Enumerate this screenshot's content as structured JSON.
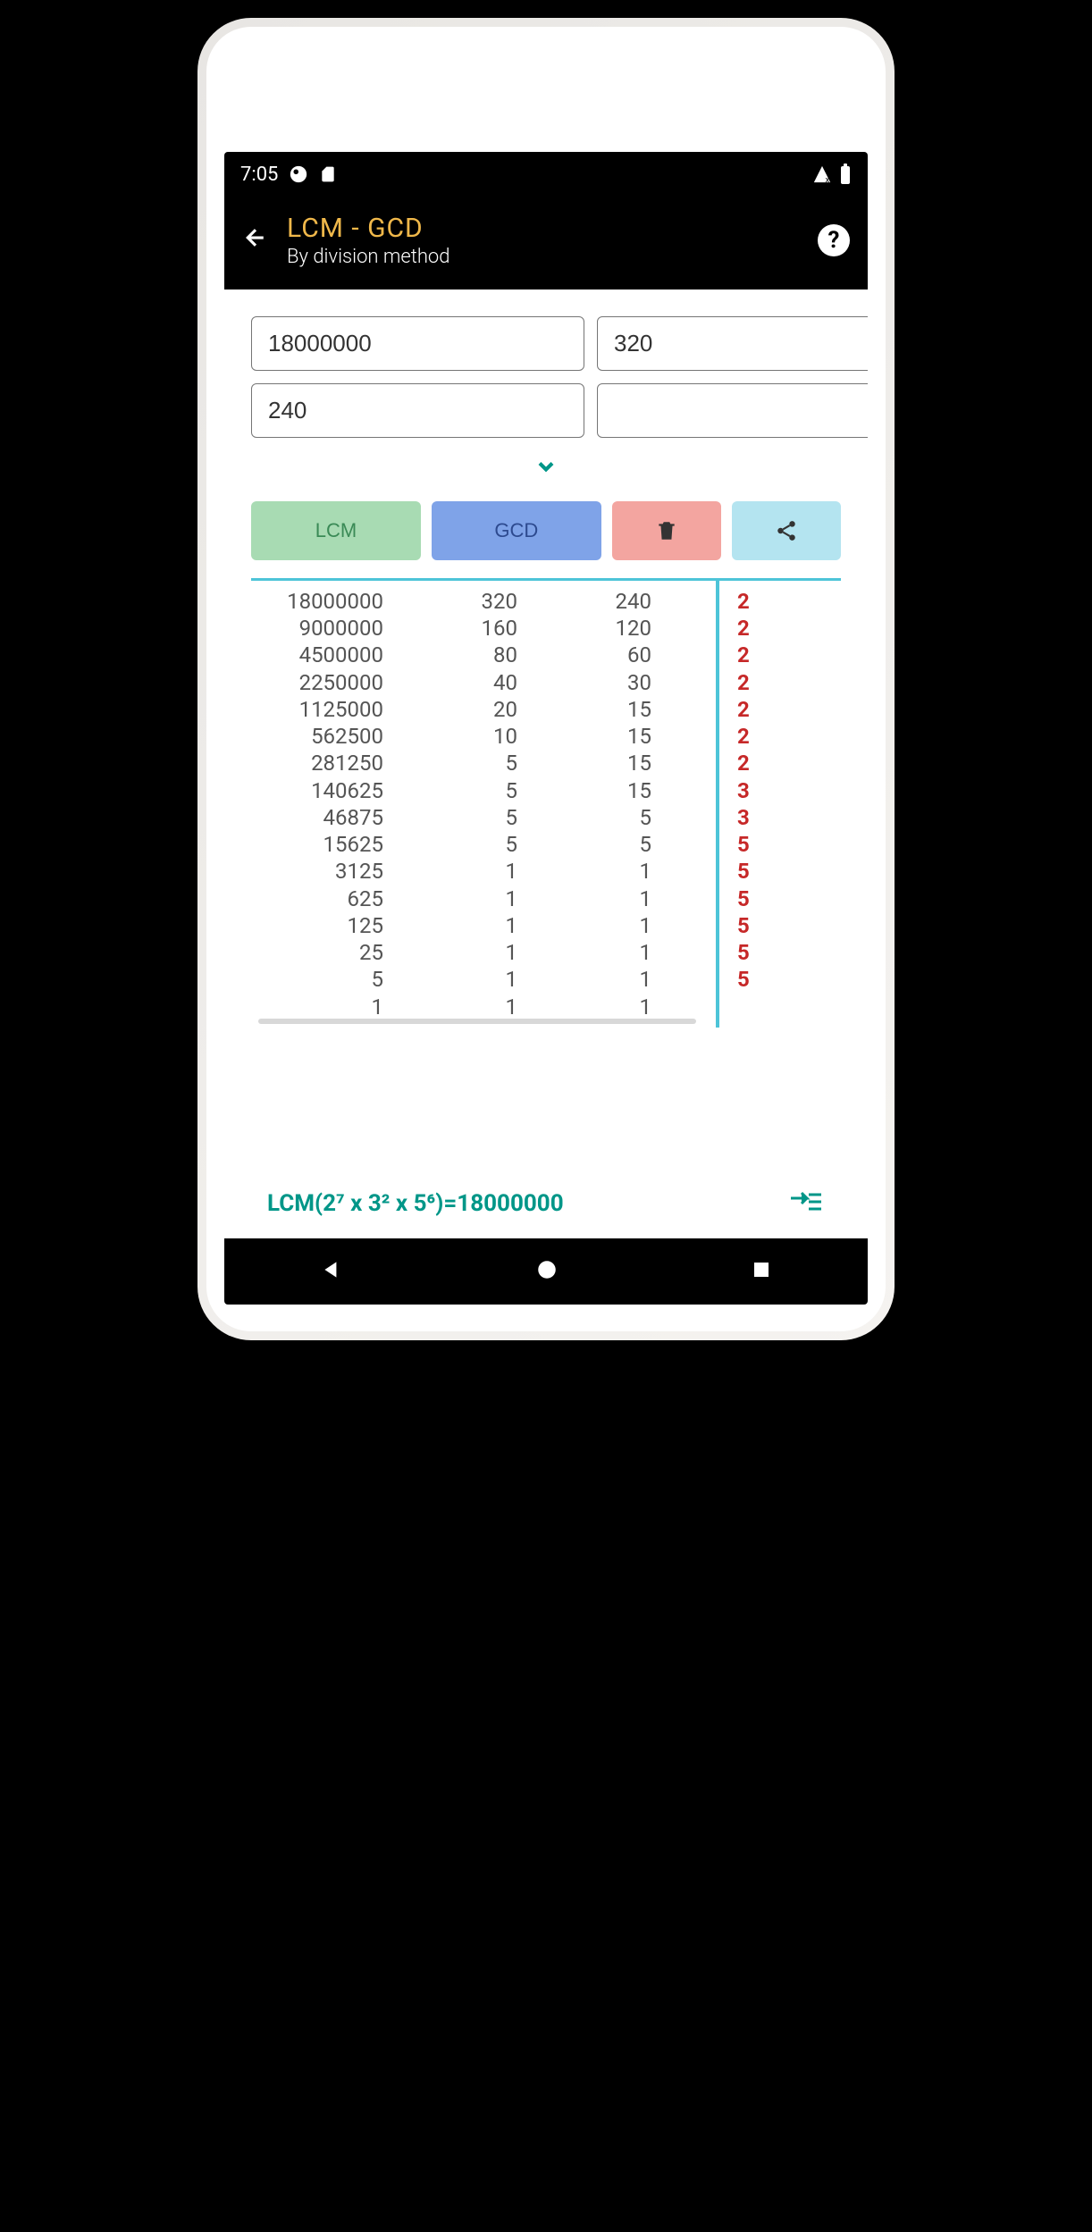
{
  "status": {
    "time": "7:05"
  },
  "appbar": {
    "title": "LCM - GCD",
    "subtitle": "By division method"
  },
  "inputs": {
    "a": "18000000",
    "b": "320",
    "c": "240",
    "d": ""
  },
  "buttons": {
    "lcm": "LCM",
    "gcd": "GCD"
  },
  "table": {
    "col1": [
      "18000000",
      "9000000",
      "4500000",
      "2250000",
      "1125000",
      "562500",
      "281250",
      "140625",
      "46875",
      "15625",
      "3125",
      "625",
      "125",
      "25",
      "5",
      "1"
    ],
    "col2": [
      "320",
      "160",
      "80",
      "40",
      "20",
      "10",
      "5",
      "5",
      "5",
      "5",
      "1",
      "1",
      "1",
      "1",
      "1",
      "1"
    ],
    "col3": [
      "240",
      "120",
      "60",
      "30",
      "15",
      "15",
      "15",
      "15",
      "5",
      "5",
      "1",
      "1",
      "1",
      "1",
      "1",
      "1"
    ],
    "divisors": [
      "2",
      "2",
      "2",
      "2",
      "2",
      "2",
      "2",
      "3",
      "3",
      "5",
      "5",
      "5",
      "5",
      "5",
      "5"
    ]
  },
  "result": {
    "text": "LCM(2⁷ x 3² x 5⁶)=18000000"
  }
}
